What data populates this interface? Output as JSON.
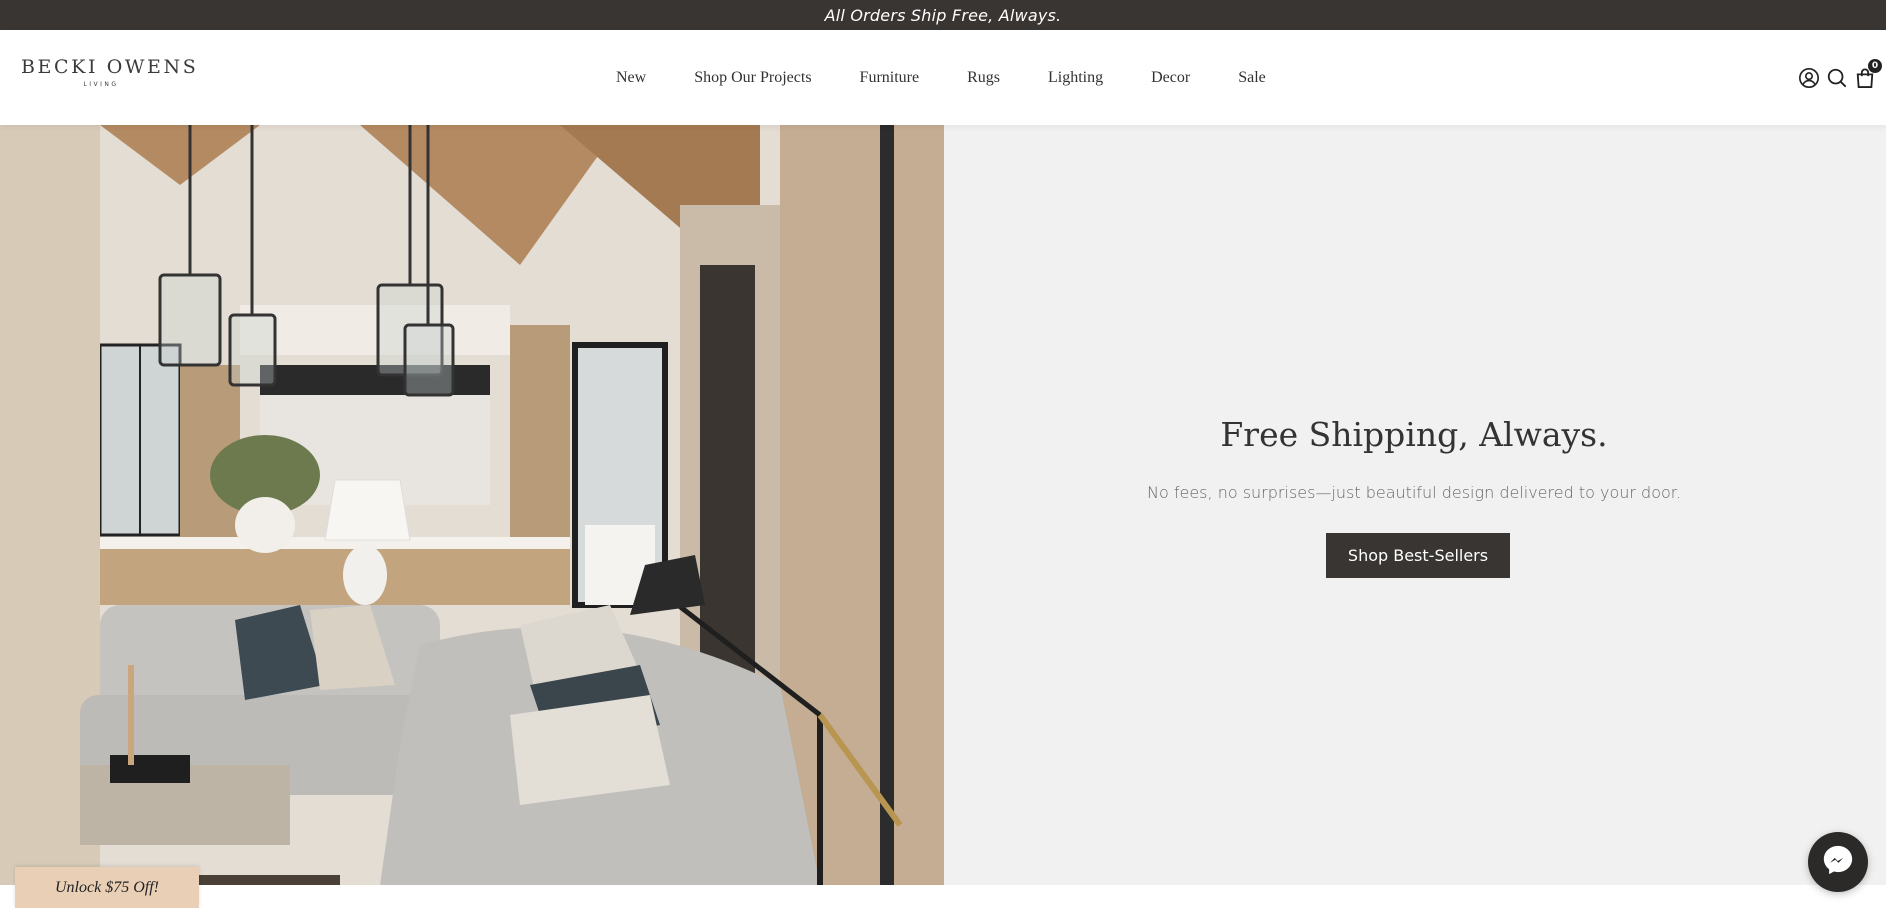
{
  "announcement": {
    "text": "All Orders Ship Free, Always."
  },
  "header": {
    "logo_main": "BECKI OWENS",
    "logo_sub": "LIVING",
    "nav": [
      {
        "label": "New"
      },
      {
        "label": "Shop Our Projects"
      },
      {
        "label": "Furniture"
      },
      {
        "label": "Rugs"
      },
      {
        "label": "Lighting"
      },
      {
        "label": "Decor"
      },
      {
        "label": "Sale"
      }
    ],
    "icons": {
      "account": "account-icon",
      "search": "search-icon",
      "cart": "cart-icon"
    },
    "cart_count": "0"
  },
  "hero": {
    "image_subject": "living-room-interior",
    "title": "Free Shipping, Always.",
    "subtitle": "No fees, no surprises—just beautiful design delivered to your door.",
    "button_label": "Shop Best-Sellers"
  },
  "promo_tab": {
    "label": "Unlock $75 Off!"
  },
  "chat": {
    "icon": "messenger-icon"
  },
  "colors": {
    "announcement_bg": "#393532",
    "button_bg": "#393532",
    "panel_bg": "#f1f1f1",
    "promo_bg": "#e9cfb6"
  }
}
